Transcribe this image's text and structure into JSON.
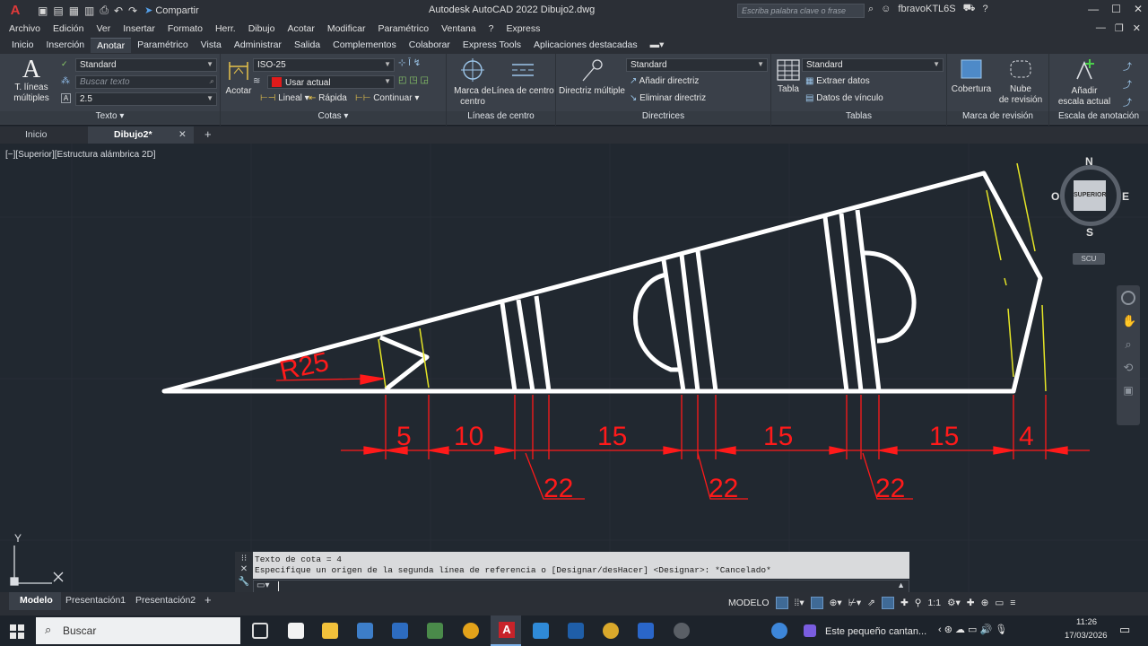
{
  "titlebar": {
    "app_logo": "A",
    "share_label": "Compartir",
    "title": "Autodesk AutoCAD 2022   Dibujo2.dwg",
    "search_placeholder": "Escriba palabra clave o frase",
    "user": "fbravoKTL6S"
  },
  "menu": [
    "Archivo",
    "Edición",
    "Ver",
    "Insertar",
    "Formato",
    "Herr.",
    "Dibujo",
    "Acotar",
    "Modificar",
    "Paramétrico",
    "Ventana",
    "?",
    "Express"
  ],
  "ribbon_tabs": [
    "Inicio",
    "Inserción",
    "Anotar",
    "Paramétrico",
    "Vista",
    "Administrar",
    "Salida",
    "Complementos",
    "Colaborar",
    "Express Tools",
    "Aplicaciones destacadas"
  ],
  "ribbon_active_tab": "Anotar",
  "ribbon": {
    "texto": {
      "big_label_1": "T. líneas",
      "big_label_2": "múltiples",
      "style": "Standard",
      "search_placeholder": "Buscar texto",
      "height": "2.5",
      "footer": "Texto"
    },
    "cotas": {
      "big_label": "Acotar",
      "style": "ISO-25",
      "layer": "Usar actual",
      "lineal": "Lineal",
      "rapida": "Rápida",
      "continuar": "Continuar",
      "footer": "Cotas"
    },
    "centro": {
      "btn1_1": "Marca de",
      "btn1_2": "centro",
      "btn2": "Línea de centro",
      "footer": "Líneas de centro"
    },
    "directrices": {
      "big_label": "Directriz múltiple",
      "style": "Standard",
      "add": "Añadir directriz",
      "remove": "Eliminar directriz",
      "footer": "Directrices"
    },
    "tablas": {
      "big_label": "Tabla",
      "style": "Standard",
      "extract": "Extraer datos",
      "link": "Datos de vínculo",
      "footer": "Tablas"
    },
    "revision": {
      "btn1": "Cobertura",
      "btn2_1": "Nube",
      "btn2_2": "de revisión",
      "footer": "Marca de revisión"
    },
    "escala": {
      "btn_1": "Añadir",
      "btn_2": "escala actual",
      "footer": "Escala de anotación"
    }
  },
  "doc_tabs": [
    "Inicio",
    "Dibujo2*"
  ],
  "view_label": "[−][Superior][Estructura alámbrica 2D]",
  "viewcube": {
    "n": "N",
    "s": "S",
    "e": "E",
    "w": "O",
    "face": "SUPERIOR",
    "ucs": "SCU"
  },
  "drawing": {
    "radius_label": "R25",
    "dims": [
      "5",
      "10",
      "15",
      "15",
      "15",
      "4"
    ],
    "dims_small": [
      "22",
      "22",
      "22"
    ],
    "colors": {
      "outline": "#ffffff",
      "dimension": "#ff1a1a",
      "hatch": "#e5e526"
    }
  },
  "ucs": {
    "y": "Y"
  },
  "command": {
    "line1": "Texto de cota = 4",
    "line2": "Especifique un origen de la segunda línea de referencia o [Designar/desHacer] <Designar>: *Cancelado*"
  },
  "layout_tabs": [
    "Modelo",
    "Presentación1",
    "Presentación2"
  ],
  "status": {
    "space": "MODELO",
    "scale": "1:1"
  },
  "taskbar": {
    "search": "Buscar",
    "notice": "Este pequeño cantan...",
    "time": "11:26",
    "date": "17/03/2026"
  }
}
